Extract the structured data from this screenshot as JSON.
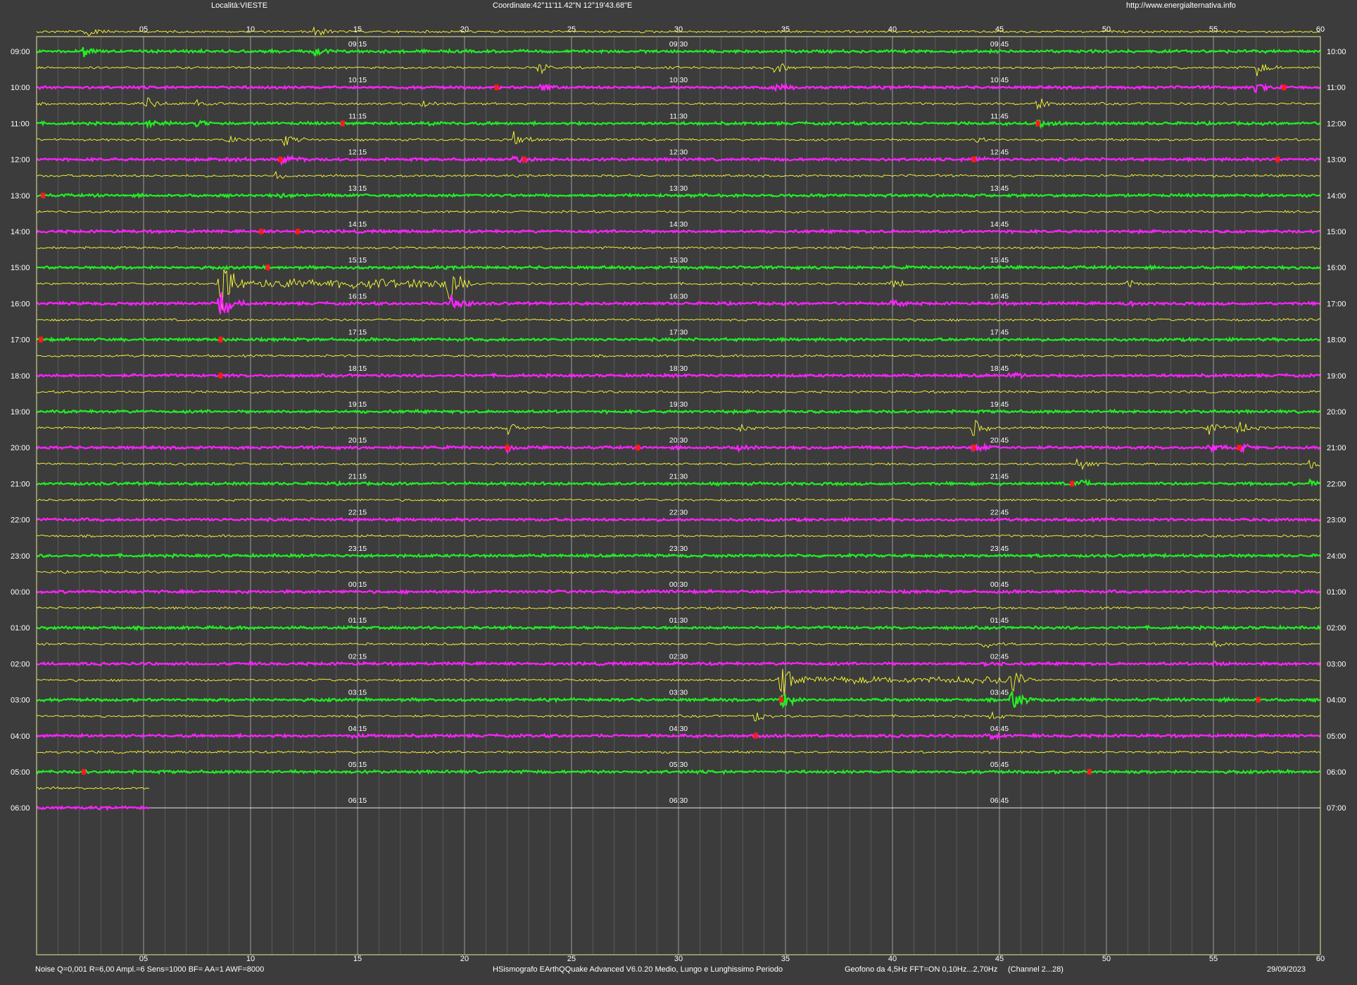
{
  "header": {
    "location": "Località:VIESTE",
    "coordinates": "Coordinate:42°11'11.42\"N  12°19'43.68\"E",
    "url": "http://www.energialternativa.info"
  },
  "footer": {
    "settings": "Noise Q=0,001 R=6,00 Ampl.=6 Sens=1000 BF= AA=1 AWF=8000",
    "software": "HSismografo  EArthQQuake Advanced V6.0.20  Medio, Lungo e Lunghissimo Periodo",
    "geofono": "Geofono da 4,5Hz FFT=ON 0,10Hz...2,70Hz",
    "channel": "(Channel 2...28)",
    "date": "29/09/2023"
  },
  "colors": {
    "background": "#3c3c3c",
    "plot_border": "#e8e8a0",
    "grid_major": "#b4b4b4",
    "grid_minor": "#6e6e6e",
    "trace_yellow": "#ffff33",
    "trace_green": "#22ee22",
    "trace_magenta": "#ff22ff",
    "event_red": "#ff1a1a",
    "text": "#ffffff"
  },
  "chart_data": {
    "type": "line",
    "title": "",
    "x_axis": {
      "unit": "minutes",
      "range": [
        0,
        60
      ],
      "tick_labels": [
        "05",
        "10",
        "15",
        "20",
        "25",
        "30",
        "35",
        "40",
        "45",
        "50",
        "55",
        "60"
      ]
    },
    "rows_left_labels": [
      "09:00",
      "10:00",
      "11:00",
      "12:00",
      "13:00",
      "14:00",
      "15:00",
      "16:00",
      "17:00",
      "18:00",
      "19:00",
      "20:00",
      "21:00",
      "22:00",
      "23:00",
      "00:00",
      "01:00",
      "02:00",
      "03:00",
      "04:00",
      "05:00",
      "06:00"
    ],
    "rows_right_labels": [
      "10:00",
      "11:00",
      "12:00",
      "13:00",
      "14:00",
      "15:00",
      "16:00",
      "17:00",
      "18:00",
      "19:00",
      "20:00",
      "21:00",
      "22:00",
      "23:00",
      "24:00",
      "01:00",
      "02:00",
      "03:00",
      "04:00",
      "05:00",
      "06:00",
      "07:00"
    ],
    "row_line_colors": [
      "green",
      "magenta",
      "green",
      "magenta",
      "green",
      "magenta",
      "green",
      "magenta",
      "green",
      "magenta",
      "green",
      "magenta",
      "green",
      "magenta",
      "green",
      "magenta",
      "green",
      "magenta",
      "green",
      "magenta",
      "green",
      "magenta"
    ],
    "quarter_labels": [
      [
        "09:15",
        "09:30",
        "09:45"
      ],
      [
        "10:15",
        "10:30",
        "10:45"
      ],
      [
        "11:15",
        "11:30",
        "11:45"
      ],
      [
        "12:15",
        "12:30",
        "12:45"
      ],
      [
        "13:15",
        "13:30",
        "13:45"
      ],
      [
        "14:15",
        "14:30",
        "14:45"
      ],
      [
        "15:15",
        "15:30",
        "15:45"
      ],
      [
        "16:15",
        "16:30",
        "16:45"
      ],
      [
        "17:15",
        "17:30",
        "17:45"
      ],
      [
        "18:15",
        "18:30",
        "18:45"
      ],
      [
        "19:15",
        "19:30",
        "19:45"
      ],
      [
        "20:15",
        "20:30",
        "20:45"
      ],
      [
        "21:15",
        "21:30",
        "21:45"
      ],
      [
        "22:15",
        "22:30",
        "22:45"
      ],
      [
        "23:15",
        "23:30",
        "23:45"
      ],
      [
        "00:15",
        "00:30",
        "00:45"
      ],
      [
        "01:15",
        "01:30",
        "01:45"
      ],
      [
        "02:15",
        "02:30",
        "02:45"
      ],
      [
        "03:15",
        "03:30",
        "03:45"
      ],
      [
        "04:15",
        "04:30",
        "04:45"
      ],
      [
        "05:15",
        "05:30",
        "05:45"
      ],
      [
        "06:15",
        "06:30",
        "06:45"
      ]
    ],
    "last_row_data_until_minute": 5.3,
    "events": [
      {
        "row": 0,
        "minute": 2.2,
        "amplitude": 1.2
      },
      {
        "row": 0,
        "minute": 13.0,
        "amplitude": 0.8
      },
      {
        "row": 1,
        "minute": 23.5,
        "amplitude": 1.2
      },
      {
        "row": 1,
        "minute": 34.5,
        "amplitude": 1.0
      },
      {
        "row": 1,
        "minute": 57.0,
        "amplitude": 1.2
      },
      {
        "row": 2,
        "minute": 5.2,
        "amplitude": 0.8
      },
      {
        "row": 2,
        "minute": 7.5,
        "amplitude": 0.7
      },
      {
        "row": 2,
        "minute": 18.0,
        "amplitude": 0.6
      },
      {
        "row": 2,
        "minute": 46.8,
        "amplitude": 1.0
      },
      {
        "row": 3,
        "minute": 9.0,
        "amplitude": 0.7
      },
      {
        "row": 3,
        "minute": 11.5,
        "amplitude": 1.6
      },
      {
        "row": 3,
        "minute": 22.3,
        "amplitude": 1.2
      },
      {
        "row": 3,
        "minute": 43.8,
        "amplitude": 0.8
      },
      {
        "row": 4,
        "minute": 11.2,
        "amplitude": 0.6
      },
      {
        "row": 7,
        "minute": 8.6,
        "amplitude": 4.5
      },
      {
        "row": 7,
        "minute": 19.3,
        "amplitude": 3.5
      },
      {
        "row": 7,
        "minute": 40.0,
        "amplitude": 0.8
      },
      {
        "row": 7,
        "minute": 51.0,
        "amplitude": 0.6
      },
      {
        "row": 9,
        "minute": 45.5,
        "amplitude": 0.6
      },
      {
        "row": 11,
        "minute": 22.0,
        "amplitude": 0.9
      },
      {
        "row": 11,
        "minute": 32.8,
        "amplitude": 0.7
      },
      {
        "row": 11,
        "minute": 43.8,
        "amplitude": 1.4
      },
      {
        "row": 11,
        "minute": 54.8,
        "amplitude": 1.0
      },
      {
        "row": 11,
        "minute": 56.2,
        "amplitude": 1.1
      },
      {
        "row": 12,
        "minute": 48.7,
        "amplitude": 1.0
      },
      {
        "row": 12,
        "minute": 59.5,
        "amplitude": 0.7
      },
      {
        "row": 17,
        "minute": 44.3,
        "amplitude": 0.7
      },
      {
        "row": 17,
        "minute": 55.0,
        "amplitude": 0.5
      },
      {
        "row": 18,
        "minute": 34.8,
        "amplitude": 2.5
      },
      {
        "row": 18,
        "minute": 45.6,
        "amplitude": 2.5
      },
      {
        "row": 19,
        "minute": 33.6,
        "amplitude": 1.0
      },
      {
        "row": 19,
        "minute": 44.6,
        "amplitude": 0.7
      },
      {
        "row": 19,
        "minute": 14.8,
        "amplitude": 0.5
      }
    ],
    "long_codas": [
      {
        "row": 7,
        "from_minute": 8.6,
        "to_minute": 19.3,
        "amplitude": 0.9
      },
      {
        "row": 18,
        "from_minute": 34.8,
        "to_minute": 45.6,
        "amplitude": 0.6
      }
    ],
    "red_markers": [
      {
        "row": 1,
        "minute": 21.5
      },
      {
        "row": 1,
        "minute": 58.3
      },
      {
        "row": 2,
        "minute": 14.3
      },
      {
        "row": 2,
        "minute": 46.8
      },
      {
        "row": 3,
        "minute": 11.4
      },
      {
        "row": 3,
        "minute": 22.8
      },
      {
        "row": 3,
        "minute": 43.8
      },
      {
        "row": 3,
        "minute": 58.0
      },
      {
        "row": 4,
        "minute": 0.3
      },
      {
        "row": 5,
        "minute": 10.5
      },
      {
        "row": 5,
        "minute": 12.2
      },
      {
        "row": 6,
        "minute": 10.8
      },
      {
        "row": 8,
        "minute": 0.2
      },
      {
        "row": 8,
        "minute": 8.6
      },
      {
        "row": 9,
        "minute": 8.6
      },
      {
        "row": 11,
        "minute": 22.0
      },
      {
        "row": 11,
        "minute": 28.1
      },
      {
        "row": 11,
        "minute": 43.8
      },
      {
        "row": 11,
        "minute": 56.2
      },
      {
        "row": 12,
        "minute": 48.4
      },
      {
        "row": 18,
        "minute": 34.8
      },
      {
        "row": 18,
        "minute": 57.1
      },
      {
        "row": 19,
        "minute": 33.6
      },
      {
        "row": 20,
        "minute": 2.2
      },
      {
        "row": 20,
        "minute": 49.2
      }
    ]
  }
}
